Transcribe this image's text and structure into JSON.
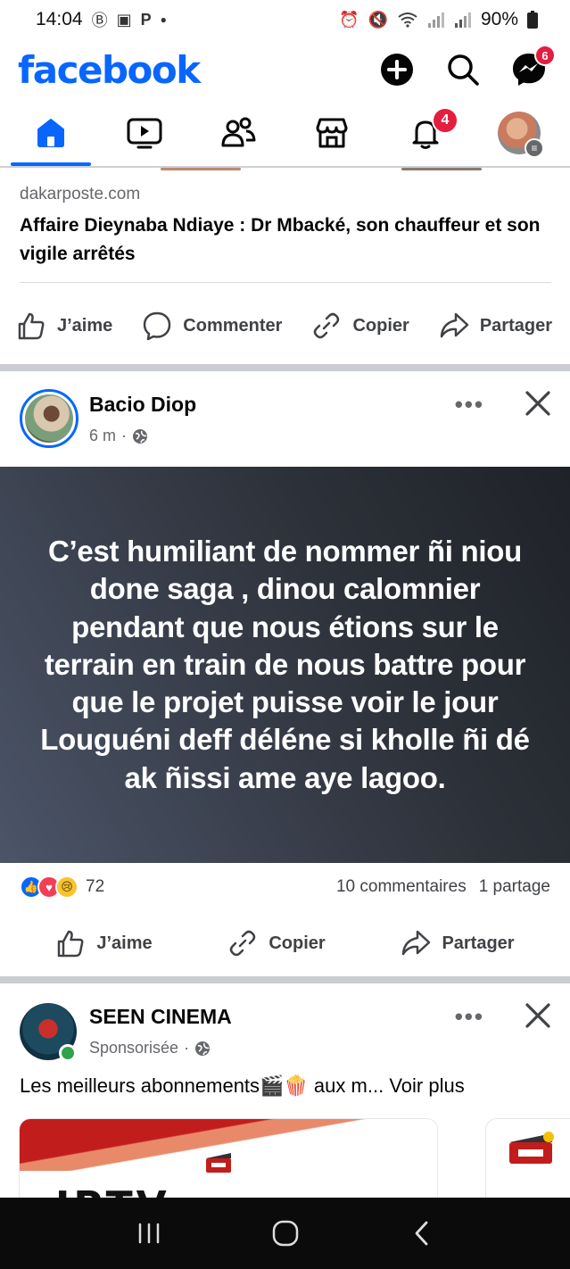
{
  "status_bar": {
    "time": "14:04",
    "left_icons": [
      "b-icon",
      "image-icon",
      "p-icon",
      "dot-icon"
    ],
    "battery": "90%",
    "right_icons": [
      "alarm-icon",
      "mute-icon",
      "wifi-icon",
      "signal-icon",
      "signal-icon",
      "battery-icon"
    ]
  },
  "header": {
    "logo": "facebook",
    "messenger_badge": "6",
    "actions": [
      "plus-icon",
      "search-icon",
      "messenger-icon"
    ]
  },
  "nav": {
    "tabs": [
      "home",
      "video",
      "friends",
      "marketplace",
      "notifications",
      "profile-menu"
    ],
    "active": "home",
    "notifications_badge": "4"
  },
  "link_post": {
    "domain": "dakarposte.com",
    "title": "Affaire Dieynaba Ndiaye : Dr Mbacké, son chauffeur et son vigile arrêtés",
    "actions": {
      "like": "J’aime",
      "comment": "Commenter",
      "copy": "Copier",
      "share": "Partager"
    }
  },
  "text_post": {
    "author": "Bacio Diop",
    "time": "6 m",
    "audience_icon": "globe-icon",
    "text": "C’est humiliant de nommer ñi niou done saga  , dinou calomnier pendant que nous étions sur le terrain en train de nous battre pour que le projet puisse voir le jour\nLouguéni deff déléne si kholle ñi dé ak ñissi ame aye lagoo.",
    "reactions": [
      "like",
      "love",
      "sad"
    ],
    "reaction_count": "72",
    "comments": "10 commentaires",
    "shares": "1 partage",
    "actions": {
      "like": "J’aime",
      "copy": "Copier",
      "share": "Partager"
    }
  },
  "sponsored_post": {
    "author": "SEEN CINEMA",
    "label": "Sponsorisée",
    "audience_icon": "globe-icon",
    "text": "Les meilleurs abonnements🎬🍿 aux m...",
    "see_more": "Voir plus",
    "card_heading": "IPTV STREAMING"
  },
  "colors": {
    "brand": "#0866ff",
    "badge": "#e41e3f",
    "text_secondary": "#65676b",
    "divider": "#c9ccd1"
  }
}
